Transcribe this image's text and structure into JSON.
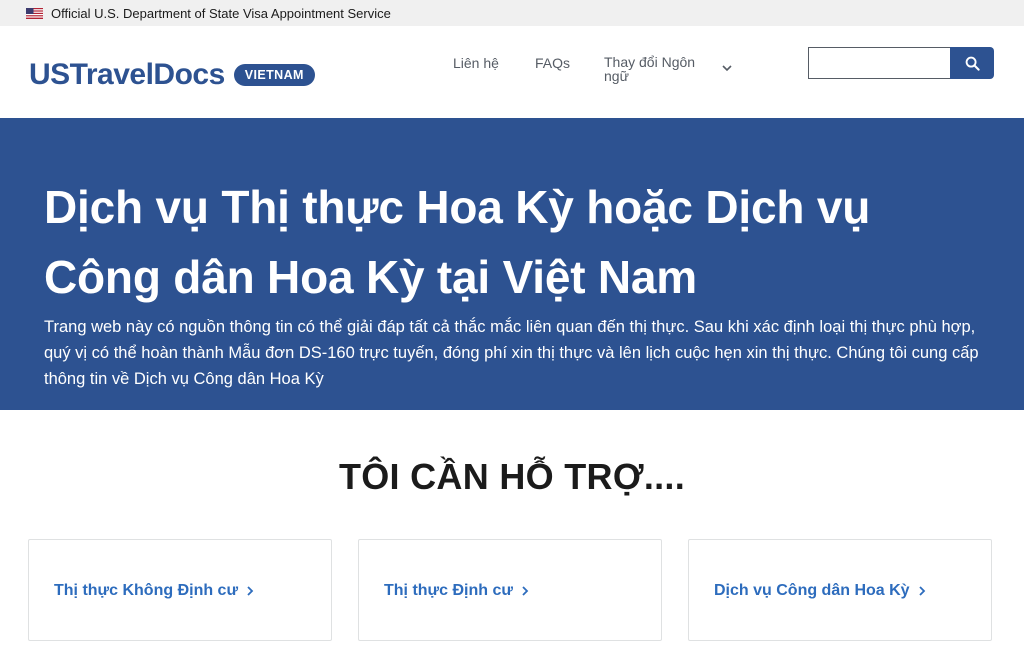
{
  "gov_banner": {
    "flag_icon": "us-flag-icon",
    "text": "Official U.S. Department of State Visa Appointment Service"
  },
  "header": {
    "logo_text": "USTravelDocs",
    "logo_badge": "VIETNAM",
    "nav": {
      "contact": "Liên hệ",
      "faqs": "FAQs",
      "language": "Thay đổi Ngôn ngữ",
      "language_icon": "chevron-down-icon"
    },
    "search": {
      "value": "",
      "placeholder": "",
      "icon": "search-icon"
    }
  },
  "hero": {
    "title": "Dịch vụ Thị thực Hoa Kỳ hoặc Dịch vụ Công dân Hoa Kỳ tại Việt Nam",
    "description": "Trang web này có nguồn thông tin có thể giải đáp tất cả thắc mắc liên quan đến thị thực. Sau khi xác định loại thị thực phù hợp, quý vị có thể hoàn thành Mẫu đơn DS-160 trực tuyến, đóng phí xin thị thực và lên lịch cuộc hẹn xin thị thực. Chúng tôi cung cấp thông tin về Dịch vụ Công dân Hoa Kỳ"
  },
  "help": {
    "title": "TÔI CẦN HỖ TRỢ....",
    "cards": [
      {
        "label": "Thị thực Không Định cư",
        "icon": "chevron-right-icon"
      },
      {
        "label": "Thị thực Định cư",
        "icon": "chevron-right-icon"
      },
      {
        "label": "Dịch vụ Công dân Hoa Kỳ",
        "icon": "chevron-right-icon"
      }
    ]
  },
  "colors": {
    "brand": "#2d5291",
    "link": "#2d6cbd",
    "banner_bg": "#f0f0f0"
  }
}
